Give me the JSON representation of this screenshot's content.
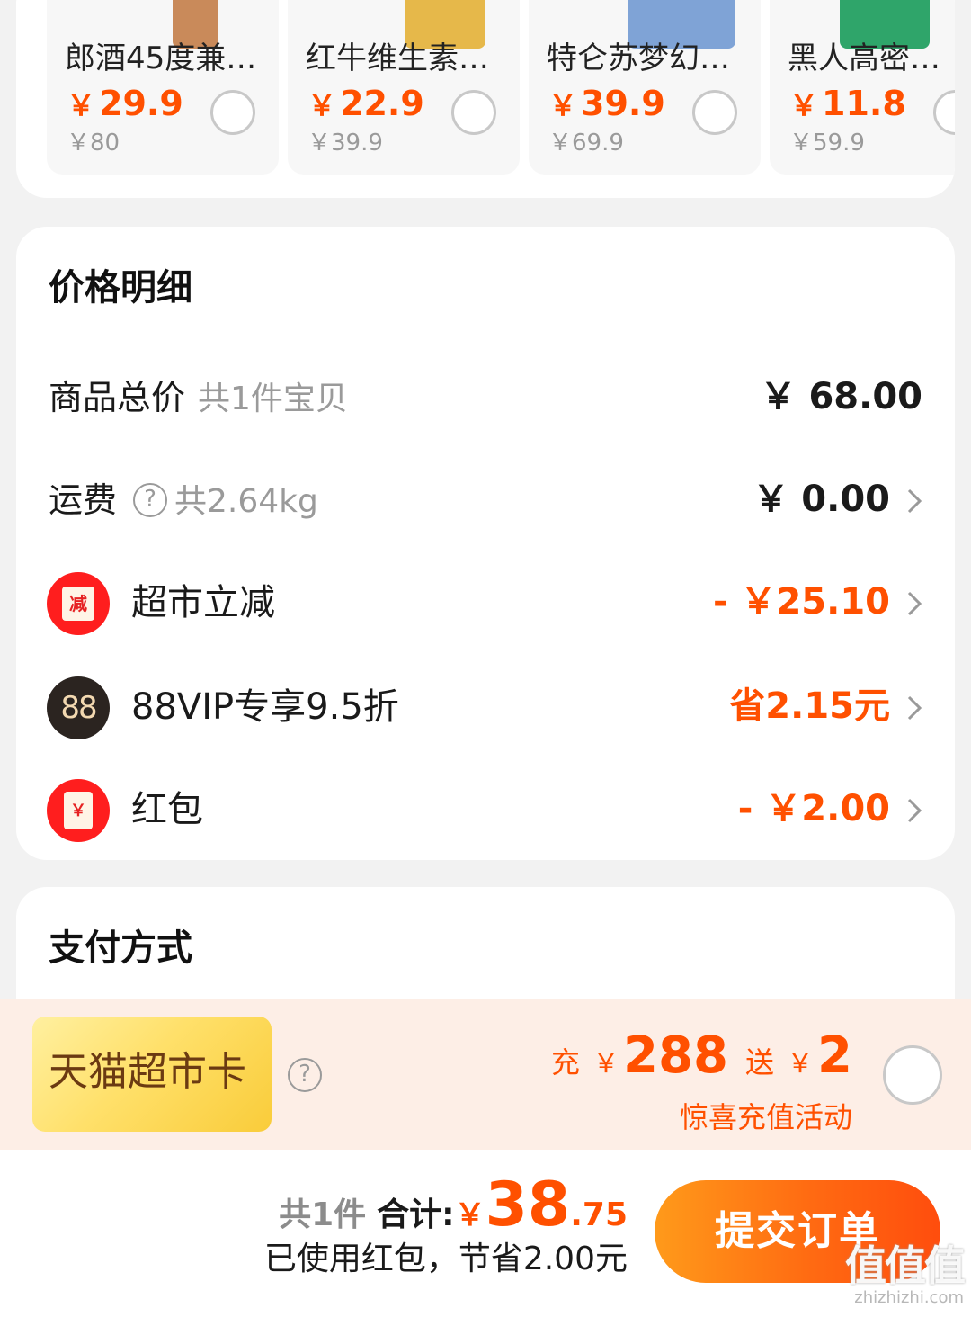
{
  "recommendations": [
    {
      "name": "郎酒45度兼…",
      "price": "29.9",
      "yen": "￥",
      "original_price": "￥80",
      "thumb_color": "#c98a5a"
    },
    {
      "name": "红牛维生素…",
      "price": "22.9",
      "yen": "￥",
      "original_price": "￥39.9",
      "thumb_color": "#e6b84a"
    },
    {
      "name": "特仑苏梦幻…",
      "price": "39.9",
      "yen": "￥",
      "original_price": "￥69.9",
      "thumb_color": "#7fa3d6"
    },
    {
      "name": "黑人高密护…",
      "price": "11.8",
      "yen": "￥",
      "original_price": "￥59.9",
      "thumb_color": "#2fa56a"
    }
  ],
  "price_detail": {
    "title": "价格明细",
    "goods_total": {
      "label": "商品总价",
      "sub": "共1件宝贝",
      "value": "￥ 68.00"
    },
    "shipping": {
      "label": "运费",
      "help": "?",
      "sub": "共2.64kg",
      "value": "￥ 0.00"
    },
    "supermarket_discount": {
      "icon_text": "减",
      "label": "超市立减",
      "value": "- ￥25.10"
    },
    "vip": {
      "icon_text": "88",
      "label": "88VIP专享9.5折",
      "value": "省2.15元"
    },
    "red_packet": {
      "icon_text": "￥",
      "label": "红包",
      "value": "- ￥2.00"
    }
  },
  "payment": {
    "title": "支付方式",
    "card_name": "天猫超市卡",
    "help": "?",
    "promo": {
      "charge_label": "充",
      "charge_yen": "￥",
      "charge_amount": "288",
      "gift_label": "送",
      "gift_yen": "￥",
      "gift_amount": "2"
    },
    "promo_sub": "惊喜充值活动"
  },
  "footer": {
    "count": "共1件",
    "total_label": "合计:",
    "total_yen": "￥",
    "total_int": "38",
    "total_dec": ".75",
    "saved_text": "已使用红包，节省2.00元",
    "submit_label": "提交订单"
  },
  "watermark": {
    "logo": "值值值",
    "url": "zhizhizhi.com"
  },
  "colors": {
    "accent": "#ff5000",
    "card_bg": "#ffffff",
    "page_bg": "#f2f2f2",
    "promo_bg": "#fdeee6"
  }
}
